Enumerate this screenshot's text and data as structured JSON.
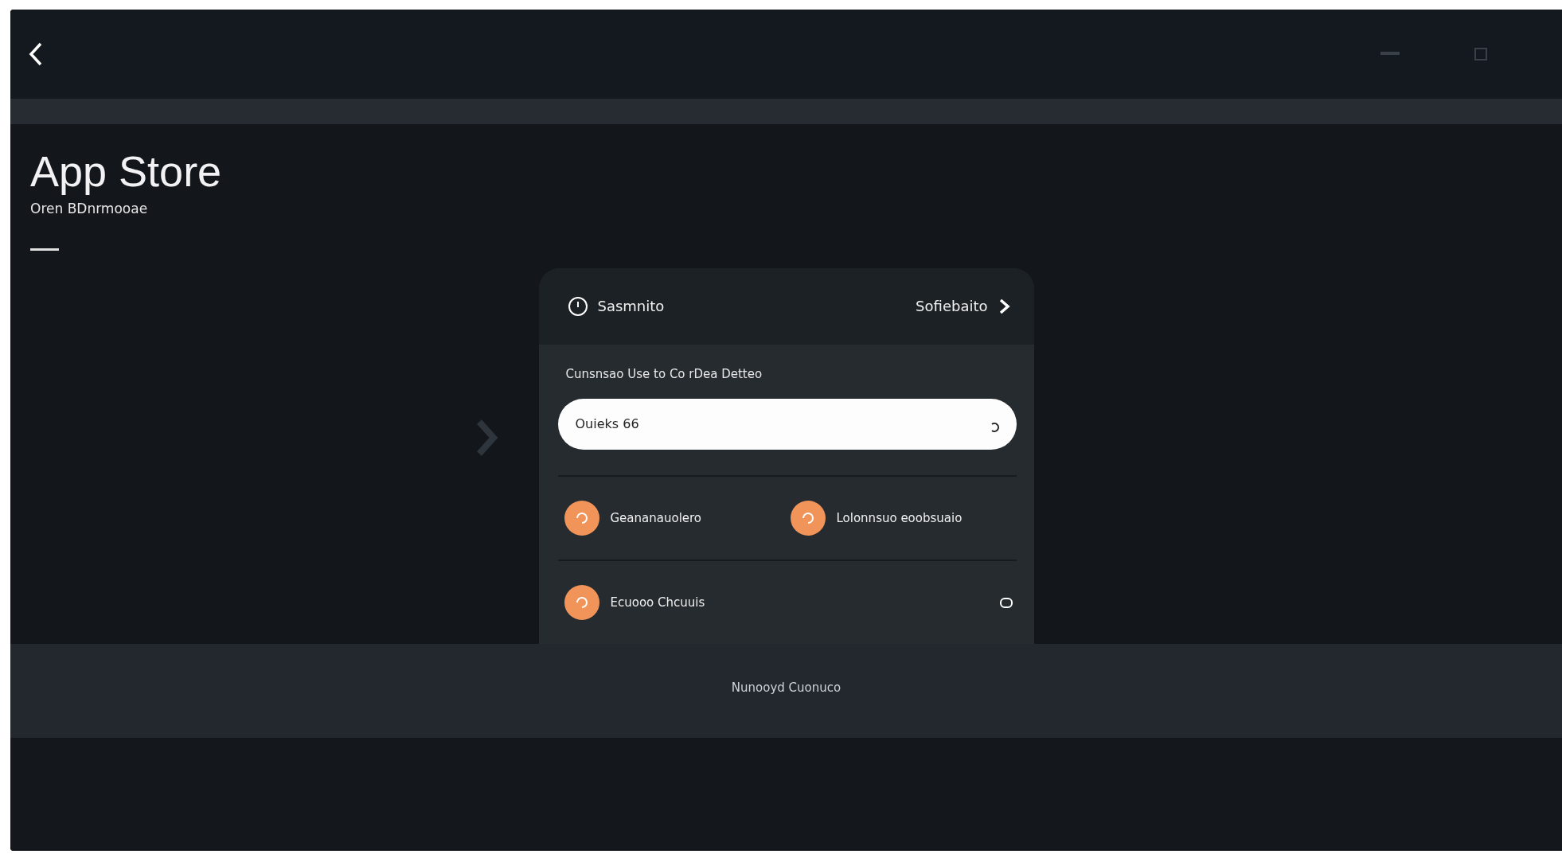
{
  "header": {
    "title": "App Store",
    "subtitle": "Oren BDnrmooae"
  },
  "card": {
    "status": "Sasmnito",
    "action": "Sofiebaito",
    "prompt": "Cunsnsao Use to Co rDea Detteo",
    "input": {
      "value": "Ouieks 66"
    },
    "options": [
      {
        "label": "Geananauolero"
      },
      {
        "label": "Lolonnsuo eoobsuaio"
      }
    ],
    "row": {
      "label": "Ecuooo Chcuuis"
    }
  },
  "footer": {
    "text": "Nunooyd Cuonuco"
  }
}
